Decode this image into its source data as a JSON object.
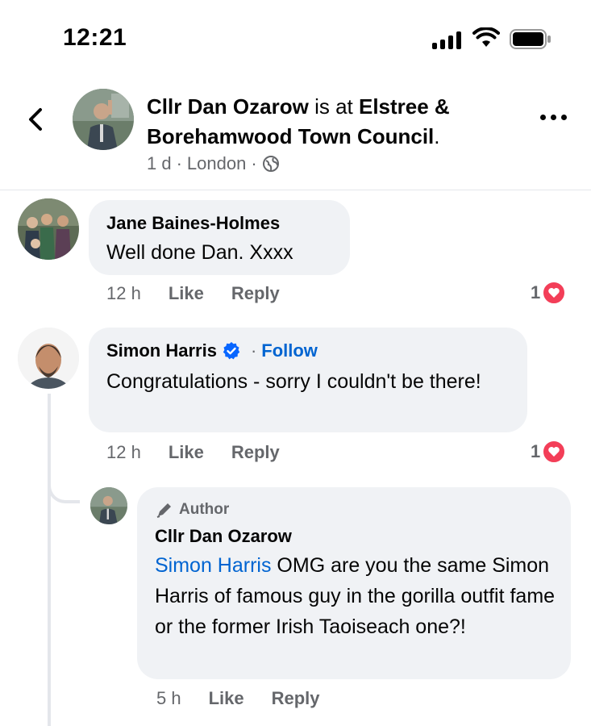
{
  "status_bar": {
    "time": "12:21"
  },
  "header": {
    "name": "Cllr Dan Ozarow",
    "is_at": "is at",
    "location": "Elstree & Borehamwood Town Council",
    "period": ".",
    "time": "1 d",
    "sep": "·",
    "place": "London",
    "sep2": "·"
  },
  "comments": [
    {
      "author": "Jane Baines-Holmes",
      "text": "Well done Dan. Xxxx",
      "time": "12 h",
      "like": "Like",
      "reply": "Reply",
      "reactions": "1"
    },
    {
      "author": "Simon Harris",
      "follow_sep": "·",
      "follow": "Follow",
      "text": "Congratulations - sorry I couldn't be there!",
      "time": "12 h",
      "like": "Like",
      "reply": "Reply",
      "reactions": "1"
    }
  ],
  "reply": {
    "badge": "Author",
    "author": "Cllr Dan Ozarow",
    "mention": "Simon Harris",
    "text": " OMG are you the same Simon Harris of famous guy in the gorilla outfit fame or the former Irish Taoiseach one?!",
    "time": "5 h",
    "like": "Like",
    "reply": "Reply"
  },
  "colors": {
    "link": "#0064d1",
    "heart": "#f33e58",
    "bubble": "#f0f2f5",
    "meta": "#65676b"
  }
}
